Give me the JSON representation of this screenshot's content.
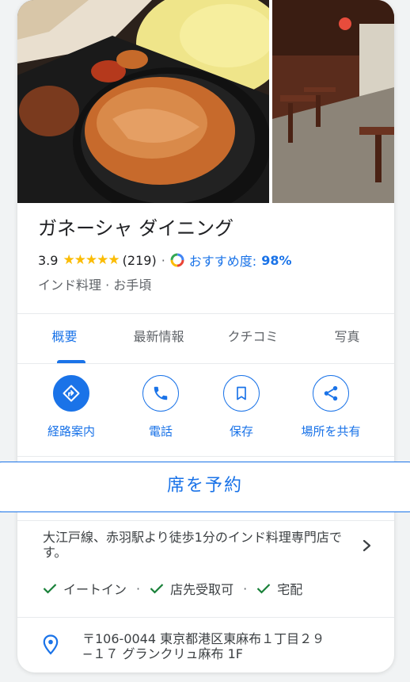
{
  "place": {
    "name": "ガネーシャ ダイニング",
    "rating": "3.9",
    "stars": "★★★★★",
    "review_count": "(219)",
    "recommend_label": "おすすめ度:",
    "recommend_pct": "98%",
    "category": "インド料理 · お手頃"
  },
  "tabs": [
    {
      "label": "概要",
      "active": true
    },
    {
      "label": "最新情報",
      "active": false
    },
    {
      "label": "クチコミ",
      "active": false
    },
    {
      "label": "写真",
      "active": false
    }
  ],
  "actions": [
    {
      "label": "経路案内",
      "icon": "directions-icon"
    },
    {
      "label": "電話",
      "icon": "phone-icon"
    },
    {
      "label": "保存",
      "icon": "bookmark-icon"
    },
    {
      "label": "場所を共有",
      "icon": "share-icon"
    }
  ],
  "reserve_label": "席を予約",
  "description": "大江戸線、赤羽駅より徒歩1分のインド料理専門店です。",
  "features": [
    "イートイン",
    "店先受取可",
    "宅配"
  ],
  "address": "〒106-0044 東京都港区東麻布１丁目２９−１７ グランクリュ麻布 1F",
  "colors": {
    "accent": "#1a73e8",
    "star": "#fbbc04",
    "text": "#202124",
    "muted": "#5f6368"
  }
}
